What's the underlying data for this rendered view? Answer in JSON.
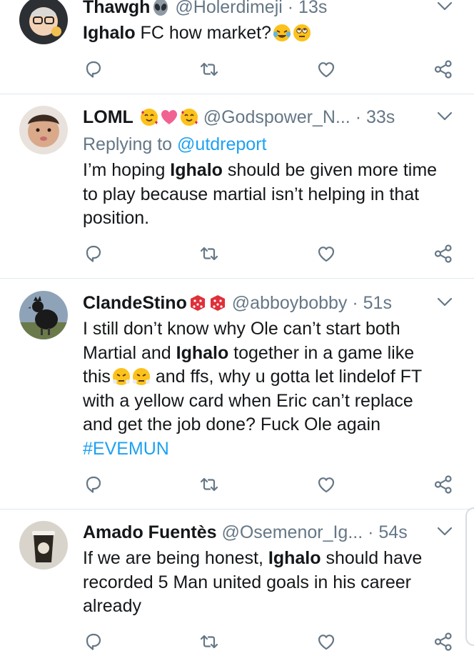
{
  "tweets": [
    {
      "name": "Thawgh",
      "name_emojis": [
        "alien-emoji"
      ],
      "handle": "@Holerdimeji",
      "dot": "·",
      "time": "13s",
      "reply_prefix": "",
      "reply_mention": "",
      "body_parts": [
        {
          "text": "Ighalo",
          "bold": true
        },
        {
          "text": " FC how market?",
          "bold": false
        }
      ],
      "body_emojis": [
        "tears-of-joy-emoji",
        "eye-roll-emoji"
      ]
    },
    {
      "name": "LOML",
      "name_emojis": [
        "smiling-hearts-emoji",
        "pink-heart-emoji",
        "smiling-hearts-emoji"
      ],
      "handle": "@Godspower_N...",
      "dot": "·",
      "time": "33s",
      "reply_prefix": "Replying to",
      "reply_mention": "@utdreport",
      "body_line1a": "I’m hoping ",
      "body_line1b": "Ighalo",
      "body_line1c": " should be given more time",
      "body_line2": "to play because martial isn’t helping in that",
      "body_line3": "position."
    },
    {
      "name": "ClandeStino",
      "name_emojis": [
        "dice-emoji",
        "dice-emoji"
      ],
      "handle": "@abboybobby",
      "dot": "·",
      "time": "51s",
      "body_line1": "I still don’t know why Ole can’t start both",
      "body_line2a": "Martial and ",
      "body_line2b": "Ighalo",
      "body_line2c": " together in a game like",
      "body_line3a": "this",
      "body_line3b": " and ffs, why u gotta let lindelof FT",
      "body_line4": "with a yellow card when Eric can’t replace",
      "body_line5": "and get the job done? Fuck Ole again",
      "hashtag": "#EVEMUN"
    },
    {
      "name": "Amado Fuentès",
      "handle": "@Osemenor_Ig...",
      "dot": "·",
      "time": "54s",
      "body_line1a": "If we are being honest, ",
      "body_line1b": "Ighalo",
      "body_line1c": " should have",
      "body_line2": "recorded 5 Man united goals in his career",
      "body_line3": "already"
    }
  ],
  "icons": {
    "reply": "reply-icon",
    "retweet": "retweet-icon",
    "like": "like-icon",
    "share": "share-icon",
    "menu": "chevron-down-icon"
  },
  "colors": {
    "link": "#1da1f2",
    "secondary_text": "#657786",
    "icon": "#657786",
    "divider": "#e1e8ed"
  }
}
